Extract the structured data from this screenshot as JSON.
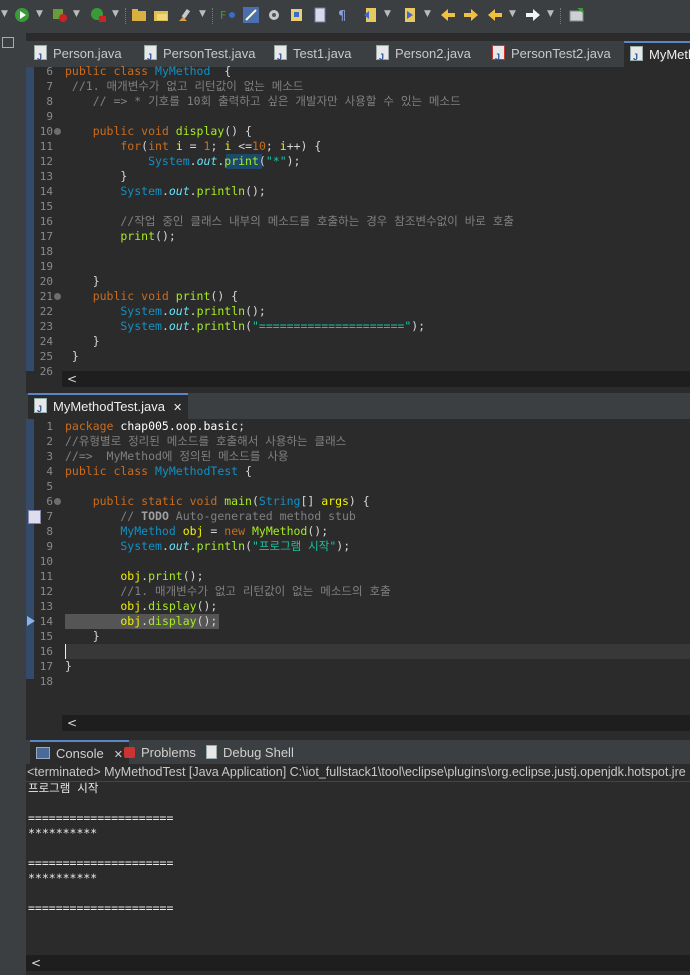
{
  "editor_tabs": [
    {
      "label": "Person.java"
    },
    {
      "label": "PersonTest.java"
    },
    {
      "label": "Test1.java"
    },
    {
      "label": "Person2.java"
    },
    {
      "label": "PersonTest2.java"
    },
    {
      "label": "MyMeth"
    }
  ],
  "editor_top": {
    "lines": [
      {
        "n": "6",
        "t": [
          [
            "kw",
            "public class "
          ],
          [
            "ty",
            "MyMethod"
          ],
          [
            "",
            "  {"
          ]
        ]
      },
      {
        "n": "7",
        "t": [
          [
            "cm",
            " //1. 매개변수가 없고 리턴값이 없는 메소드"
          ]
        ]
      },
      {
        "n": "8",
        "t": [
          [
            "cm",
            "    // => * 기호를 10회 출력하고 싶은 개발자만 사용할 수 있는 메소드"
          ]
        ]
      },
      {
        "n": "9",
        "t": []
      },
      {
        "n": "10",
        "t": [
          [
            "kw",
            "    public void "
          ],
          [
            "meth",
            "display"
          ],
          [
            "",
            "() {"
          ]
        ]
      },
      {
        "n": "11",
        "t": [
          [
            "kw",
            "        for"
          ],
          [
            "",
            "("
          ],
          [
            "kw",
            "int "
          ],
          [
            "var",
            "i"
          ],
          [
            "",
            " = "
          ],
          [
            "kw",
            "1"
          ],
          [
            "",
            "; "
          ],
          [
            "var",
            "i"
          ],
          [
            "",
            " <="
          ],
          [
            "kw",
            "10"
          ],
          [
            "",
            "; "
          ],
          [
            "var",
            "i"
          ],
          [
            "",
            "++) {"
          ]
        ]
      },
      {
        "n": "12",
        "t": [
          [
            "ty",
            "            System"
          ],
          [
            "",
            "."
          ],
          [
            "fld",
            "out"
          ],
          [
            "",
            "."
          ],
          [
            "meth",
            "print"
          ],
          [
            "",
            "("
          ],
          [
            "str",
            "\"*\""
          ],
          [
            "",
            ");"
          ]
        ]
      },
      {
        "n": "13",
        "t": [
          [
            "",
            "        }"
          ]
        ]
      },
      {
        "n": "14",
        "t": [
          [
            "ty",
            "        System"
          ],
          [
            "",
            "."
          ],
          [
            "fld",
            "out"
          ],
          [
            "",
            "."
          ],
          [
            "meth",
            "println"
          ],
          [
            "",
            "();"
          ]
        ]
      },
      {
        "n": "15",
        "t": []
      },
      {
        "n": "16",
        "t": [
          [
            "cm",
            "        //작업 중인 클래스 내부의 메소드를 호출하는 경우 참조변수없이 바로 호출"
          ]
        ]
      },
      {
        "n": "17",
        "t": [
          [
            "meth",
            "        print"
          ],
          [
            "",
            "();"
          ]
        ]
      },
      {
        "n": "18",
        "t": []
      },
      {
        "n": "19",
        "t": []
      },
      {
        "n": "20",
        "t": [
          [
            "",
            "    }"
          ]
        ]
      },
      {
        "n": "21",
        "t": [
          [
            "kw",
            "    public void "
          ],
          [
            "meth",
            "print"
          ],
          [
            "",
            "() {"
          ]
        ]
      },
      {
        "n": "22",
        "t": [
          [
            "ty",
            "        System"
          ],
          [
            "",
            "."
          ],
          [
            "fld",
            "out"
          ],
          [
            "",
            "."
          ],
          [
            "meth",
            "println"
          ],
          [
            "",
            "();"
          ]
        ]
      },
      {
        "n": "23",
        "t": [
          [
            "ty",
            "        System"
          ],
          [
            "",
            "."
          ],
          [
            "fld",
            "out"
          ],
          [
            "",
            "."
          ],
          [
            "meth",
            "println"
          ],
          [
            "",
            "("
          ],
          [
            "str",
            "\"=====================\""
          ],
          [
            "",
            ");"
          ]
        ]
      },
      {
        "n": "24",
        "t": [
          [
            "",
            "    }"
          ]
        ]
      },
      {
        "n": "25",
        "t": [
          [
            "",
            ""
          ],
          [
            "",
            ""
          ],
          [
            "",
            ""
          ],
          [
            "",
            ""
          ],
          [
            "",
            " }"
          ]
        ]
      },
      {
        "n": "26",
        "t": []
      }
    ]
  },
  "bottom_tab": {
    "label": "MyMethodTest.java",
    "close": "✕"
  },
  "editor_bottom": {
    "lines": [
      {
        "n": "1",
        "t": [
          [
            "kw",
            "package "
          ],
          [
            "pk",
            "chap005.oop.basic"
          ],
          [
            "",
            ";"
          ]
        ]
      },
      {
        "n": "2",
        "t": [
          [
            "cm",
            "//유형별로 정리된 메소드를 호출해서 사용하는 클래스"
          ]
        ]
      },
      {
        "n": "3",
        "t": [
          [
            "cm",
            "//=>  MyMethod에 정의된 메소드를 사용"
          ]
        ]
      },
      {
        "n": "4",
        "t": [
          [
            "kw",
            "public class "
          ],
          [
            "ty",
            "MyMethodTest"
          ],
          [
            "",
            " {"
          ]
        ]
      },
      {
        "n": "5",
        "t": []
      },
      {
        "n": "6",
        "t": [
          [
            "kw",
            "    public static void "
          ],
          [
            "meth",
            "main"
          ],
          [
            "",
            "("
          ],
          [
            "ty",
            "String"
          ],
          [
            "",
            "[] "
          ],
          [
            "var",
            "args"
          ],
          [
            "",
            ") {"
          ]
        ]
      },
      {
        "n": "7",
        "t": [
          [
            "cm",
            "        // "
          ],
          [
            "todo",
            "TODO"
          ],
          [
            "cm",
            " Auto-generated method stub"
          ]
        ]
      },
      {
        "n": "8",
        "t": [
          [
            "ty",
            "        MyMethod "
          ],
          [
            "var",
            "obj"
          ],
          [
            "",
            " = "
          ],
          [
            "kw",
            "new "
          ],
          [
            "meth",
            "MyMethod"
          ],
          [
            "",
            "();"
          ]
        ]
      },
      {
        "n": "9",
        "t": [
          [
            "ty",
            "        System"
          ],
          [
            "",
            "."
          ],
          [
            "fld",
            "out"
          ],
          [
            "",
            "."
          ],
          [
            "meth",
            "println"
          ],
          [
            "",
            "("
          ],
          [
            "str",
            "\"프로그램 시작\""
          ],
          [
            "",
            ");"
          ]
        ]
      },
      {
        "n": "10",
        "t": []
      },
      {
        "n": "11",
        "t": [
          [
            "var",
            "        obj"
          ],
          [
            "",
            "."
          ],
          [
            "meth",
            "print"
          ],
          [
            "",
            "();"
          ]
        ]
      },
      {
        "n": "12",
        "t": [
          [
            "cm",
            "        //1. 매개변수가 없고 리턴값이 없는 메소드의 호출"
          ]
        ]
      },
      {
        "n": "13",
        "t": [
          [
            "var",
            "        obj"
          ],
          [
            "",
            "."
          ],
          [
            "meth",
            "display"
          ],
          [
            "",
            "();"
          ]
        ]
      },
      {
        "n": "14",
        "t": [
          [
            "var",
            "        obj"
          ],
          [
            "",
            "."
          ],
          [
            "meth",
            "display"
          ],
          [
            "",
            "();"
          ]
        ]
      },
      {
        "n": "15",
        "t": [
          [
            "",
            "    }"
          ]
        ]
      },
      {
        "n": "16",
        "t": []
      },
      {
        "n": "17",
        "t": [
          [
            "",
            "}"
          ]
        ]
      },
      {
        "n": "18",
        "t": []
      }
    ]
  },
  "console_tabs": [
    {
      "label": "Console",
      "close": "✕"
    },
    {
      "label": "Problems"
    },
    {
      "label": "Debug Shell"
    }
  ],
  "console": {
    "status": "<terminated> MyMethodTest [Java Application] C:\\iot_fullstack1\\tool\\eclipse\\plugins\\org.eclipse.justj.openjdk.hotspot.jre",
    "output": [
      "프로그램 시작",
      "",
      "=====================",
      "**********",
      "",
      "=====================",
      "**********",
      "",
      "====================="
    ]
  },
  "scroll_arrow": "<",
  "colors": {
    "keyword": "#cc6c1d",
    "type": "#1290c3",
    "string": "#17c6a3",
    "comment": "#808080",
    "field": "#66e1f8",
    "variable": "#f2f200",
    "method": "#a7ec21"
  }
}
